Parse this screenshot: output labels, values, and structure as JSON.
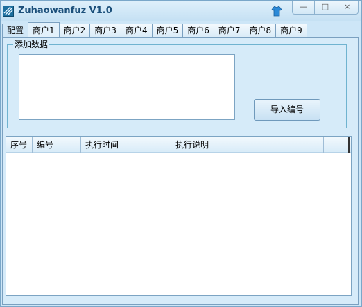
{
  "window": {
    "title": "Zuhaowanfuz V1.0",
    "controls": {
      "minimize": "—",
      "maximize": "□",
      "close": "×"
    }
  },
  "tabs": [
    {
      "label": "配置"
    },
    {
      "label": "商户1"
    },
    {
      "label": "商户2"
    },
    {
      "label": "商户3"
    },
    {
      "label": "商户4"
    },
    {
      "label": "商户5"
    },
    {
      "label": "商户6"
    },
    {
      "label": "商户7"
    },
    {
      "label": "商户8"
    },
    {
      "label": "商户9"
    }
  ],
  "active_tab": "商户1",
  "add_data": {
    "legend": "添加数据",
    "text_value": "",
    "import_button": "导入编号"
  },
  "list": {
    "columns": [
      "序号",
      "编号",
      "执行时间",
      "执行说明",
      ""
    ],
    "rows": []
  }
}
